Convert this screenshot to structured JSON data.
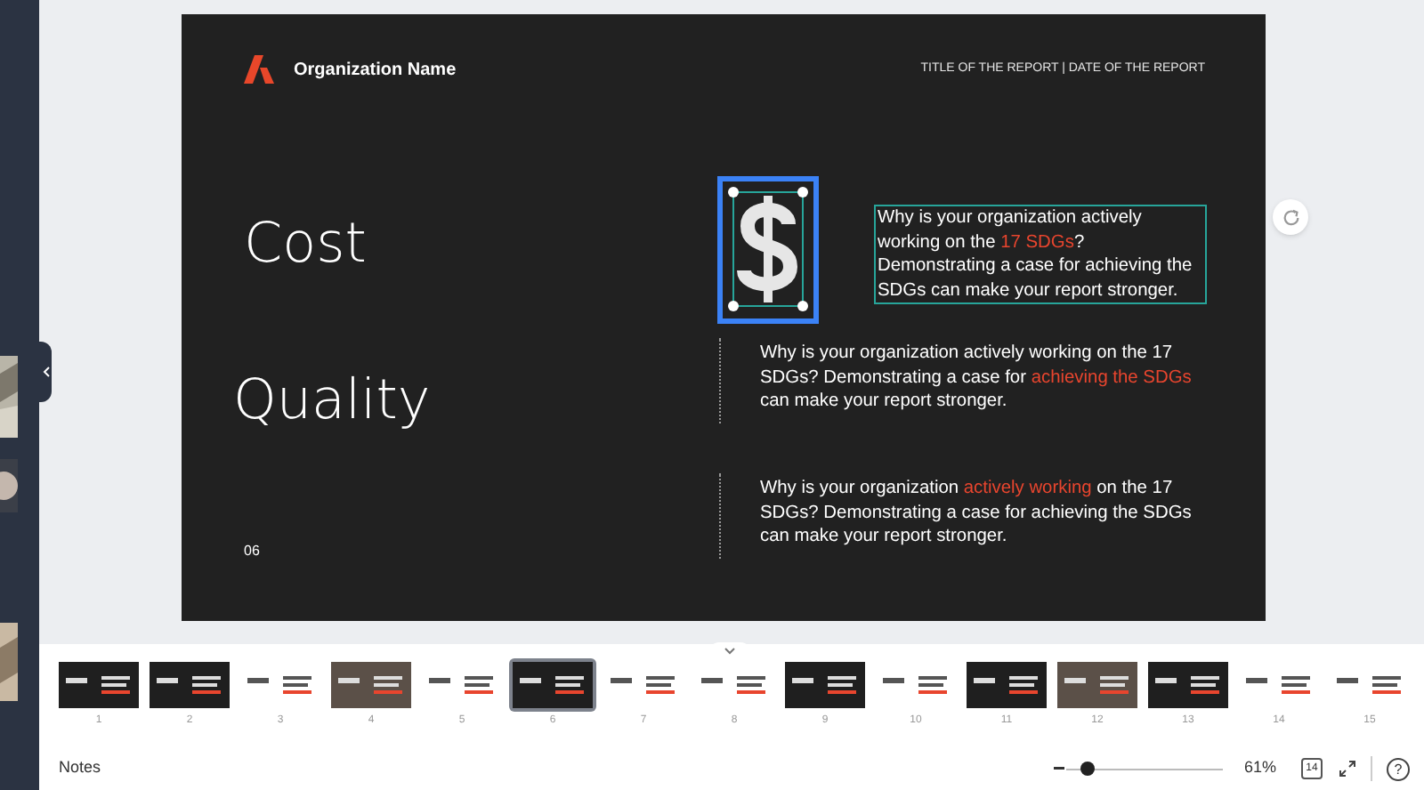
{
  "slide": {
    "organization": "Organization Name",
    "header_right": "TITLE OF THE REPORT | DATE OF THE REPORT",
    "headings": [
      "Cost",
      "Quality"
    ],
    "page_number": "06",
    "paragraphs": [
      {
        "selected": true,
        "segments": [
          {
            "text": "Why is your organization actively working on the ",
            "highlight": false
          },
          {
            "text": "17 SDGs",
            "highlight": true
          },
          {
            "text": "? Demonstrating a case for achieving the SDGs can make your report stronger.",
            "highlight": false
          }
        ]
      },
      {
        "selected": false,
        "segments": [
          {
            "text": "Why is your organization actively working on the 17 SDGs? Demonstrating a case for ",
            "highlight": false
          },
          {
            "text": "achieving the SDGs",
            "highlight": true
          },
          {
            "text": " can make your report stronger.",
            "highlight": false
          }
        ]
      },
      {
        "selected": false,
        "segments": [
          {
            "text": "Why is your organization ",
            "highlight": false
          },
          {
            "text": "actively working",
            "highlight": true
          },
          {
            "text": " on the 17 SDGs? Demonstrating a case for achieving the SDGs can make your report stronger.",
            "highlight": false
          }
        ]
      }
    ],
    "dollar_selected": true
  },
  "thumbnails": [
    {
      "number": "1",
      "kind": "dark",
      "selected": false
    },
    {
      "number": "2",
      "kind": "dark",
      "selected": false
    },
    {
      "number": "3",
      "kind": "light",
      "selected": false
    },
    {
      "number": "4",
      "selected": false
    },
    {
      "number": "5",
      "kind": "light",
      "selected": false
    },
    {
      "number": "6",
      "kind": "dark",
      "selected": true
    },
    {
      "number": "7",
      "kind": "light",
      "selected": false
    },
    {
      "number": "8",
      "kind": "light",
      "selected": false
    },
    {
      "number": "9",
      "kind": "dark",
      "selected": false
    },
    {
      "number": "10",
      "kind": "light",
      "selected": false
    },
    {
      "number": "11",
      "kind": "dark",
      "selected": false
    },
    {
      "number": "12",
      "selected": false
    },
    {
      "number": "13",
      "kind": "dark",
      "selected": false
    },
    {
      "number": "14",
      "kind": "light",
      "selected": false
    },
    {
      "number": "15",
      "kind": "light",
      "selected": false
    }
  ],
  "footer": {
    "notes": "Notes",
    "zoom": {
      "level": 0.1
    },
    "zoom_reading": "61%",
    "page_count": "14",
    "help": "?"
  }
}
